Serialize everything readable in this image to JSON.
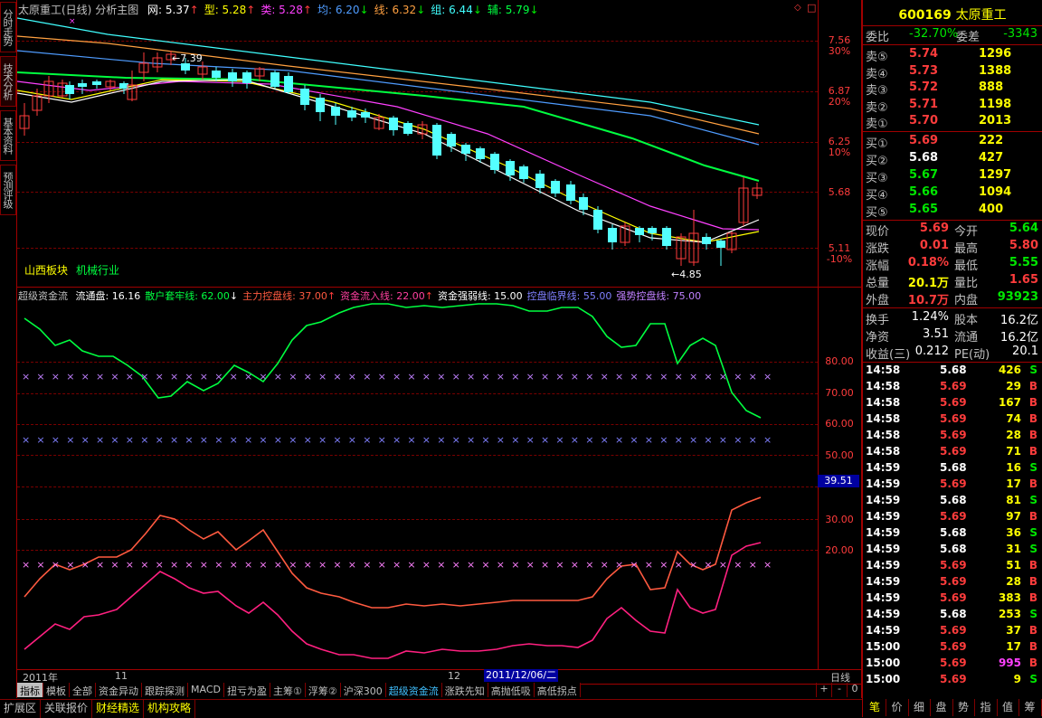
{
  "header": {
    "title": "太原重工(日线)",
    "chart_name": "分析主图",
    "indicators": [
      {
        "label": "网: 5.37",
        "color": "#ffffff",
        "arrow": "↑",
        "arrow_color": "#ff3c3c"
      },
      {
        "label": "型: 5.28",
        "color": "#ffff00",
        "arrow": "↑",
        "arrow_color": "#ff3c3c"
      },
      {
        "label": "类: 5.28",
        "color": "#ff40ff",
        "arrow": "↑",
        "arrow_color": "#ff3c3c"
      },
      {
        "label": "均: 6.20",
        "color": "#4f9cff",
        "arrow": "↓",
        "arrow_color": "#00e600"
      },
      {
        "label": "线: 6.32",
        "color": "#ffa040",
        "arrow": "↓",
        "arrow_color": "#00e600"
      },
      {
        "label": "组: 6.44",
        "color": "#40ffff",
        "arrow": "↓",
        "arrow_color": "#00e600"
      },
      {
        "label": "辅: 5.79",
        "color": "#00ff40",
        "arrow": "↓",
        "arrow_color": "#00e600"
      }
    ]
  },
  "left_tabs": [
    "分时走势",
    "技术分析",
    "基本资料",
    "预测评级"
  ],
  "price_chart": {
    "axis_labels": [
      {
        "price": "7.56",
        "pct": "30%"
      },
      {
        "price": "6.87",
        "pct": "20%"
      },
      {
        "price": "6.25",
        "pct": "10%"
      },
      {
        "price": "5.68",
        "pct": ""
      },
      {
        "price": "5.11",
        "pct": "-10%"
      }
    ],
    "high_marker": "7.39",
    "low_marker": "4.85",
    "sector_label": "山西板块",
    "industry_label": "机械行业"
  },
  "indicator_panel": {
    "name": "超级资金流",
    "items": [
      {
        "label": "流通盘: 16.16",
        "color": "#ffffff",
        "arrow": ""
      },
      {
        "label": "散户套牢线: 62.00",
        "color": "#00ff40",
        "arrow": "↓",
        "arrow_color": "#ffffff"
      },
      {
        "label": "主力控盘线: 37.00",
        "color": "#ff5a40",
        "arrow": "↑",
        "arrow_color": "#ff3c3c"
      },
      {
        "label": "资金流入线: 22.00",
        "color": "#ff40a0",
        "arrow": "↑",
        "arrow_color": "#ff3c3c"
      },
      {
        "label": "资金强弱线: 15.00",
        "color": "#ffffff",
        "arrow": ""
      },
      {
        "label": "控盘临界线: 55.00",
        "color": "#8080ff",
        "arrow": ""
      },
      {
        "label": "强势控盘线: 75.00",
        "color": "#c080ff",
        "arrow": ""
      }
    ],
    "axis_labels": [
      "80.00",
      "70.00",
      "60.00",
      "50.00",
      "30.00",
      "20.00"
    ],
    "cursor_value": "39.51"
  },
  "date_axis": {
    "year_label": "2011年",
    "month_11": "11",
    "month_12": "12",
    "cursor_date": "2011/12/06/二",
    "period": "日线"
  },
  "bottom_tabs": [
    "指标",
    "模板",
    "全部",
    "资金异动",
    "跟踪探测",
    "MACD",
    "扭亏为盈",
    "主筹①",
    "浮筹②",
    "沪深300",
    "超级资金流",
    "涨跌先知",
    "高抛低吸",
    "高低拐点"
  ],
  "zoom_controls": [
    "+",
    "-",
    "0"
  ],
  "status_bar": [
    "扩展区",
    "关联报价",
    "财经精选",
    "机构攻略"
  ],
  "quote": {
    "code": "600169",
    "name": "太原重工",
    "weibi_label": "委比",
    "weibi": "-32.70%",
    "weicha_label": "委差",
    "weicha": "-3343",
    "asks": [
      {
        "label": "卖⑤",
        "price": "5.74",
        "vol": "1296"
      },
      {
        "label": "卖④",
        "price": "5.73",
        "vol": "1388"
      },
      {
        "label": "卖③",
        "price": "5.72",
        "vol": "888"
      },
      {
        "label": "卖②",
        "price": "5.71",
        "vol": "1198"
      },
      {
        "label": "卖①",
        "price": "5.70",
        "vol": "2013"
      }
    ],
    "bids": [
      {
        "label": "买①",
        "price": "5.69",
        "vol": "222",
        "color": "#ff3c3c"
      },
      {
        "label": "买②",
        "price": "5.68",
        "vol": "427",
        "color": "#ffffff"
      },
      {
        "label": "买③",
        "price": "5.67",
        "vol": "1297",
        "color": "#00e600"
      },
      {
        "label": "买④",
        "price": "5.66",
        "vol": "1094",
        "color": "#00e600"
      },
      {
        "label": "买⑤",
        "price": "5.65",
        "vol": "400",
        "color": "#00e600"
      }
    ],
    "stats": [
      {
        "l1": "现价",
        "v1": "5.69",
        "c1": "#ff3c3c",
        "l2": "今开",
        "v2": "5.64",
        "c2": "#00e600"
      },
      {
        "l1": "涨跌",
        "v1": "0.01",
        "c1": "#ff3c3c",
        "l2": "最高",
        "v2": "5.80",
        "c2": "#ff3c3c"
      },
      {
        "l1": "涨幅",
        "v1": "0.18%",
        "c1": "#ff3c3c",
        "l2": "最低",
        "v2": "5.55",
        "c2": "#00e600"
      },
      {
        "l1": "总量",
        "v1": "20.1万",
        "c1": "#ffff00",
        "l2": "量比",
        "v2": "1.65",
        "c2": "#ff3c3c"
      },
      {
        "l1": "外盘",
        "v1": "10.7万",
        "c1": "#ff3c3c",
        "l2": "内盘",
        "v2": "93923",
        "c2": "#00e600"
      }
    ],
    "fundamentals": [
      {
        "l1": "换手",
        "v1": "1.24%",
        "l2": "股本",
        "v2": "16.2亿"
      },
      {
        "l1": "净资",
        "v1": "3.51",
        "l2": "流通",
        "v2": "16.2亿"
      },
      {
        "l1": "收益(三)",
        "v1": "0.212",
        "l2": "PE(动)",
        "v2": "20.1"
      }
    ],
    "ticks": [
      {
        "time": "14:58",
        "price": "5.68",
        "vol": "426",
        "side": "S"
      },
      {
        "time": "14:58",
        "price": "5.69",
        "vol": "29",
        "side": "B"
      },
      {
        "time": "14:58",
        "price": "5.69",
        "vol": "167",
        "side": "B"
      },
      {
        "time": "14:58",
        "price": "5.69",
        "vol": "74",
        "side": "B"
      },
      {
        "time": "14:58",
        "price": "5.69",
        "vol": "28",
        "side": "B"
      },
      {
        "time": "14:58",
        "price": "5.69",
        "vol": "71",
        "side": "B"
      },
      {
        "time": "14:59",
        "price": "5.68",
        "vol": "16",
        "side": "S"
      },
      {
        "time": "14:59",
        "price": "5.69",
        "vol": "17",
        "side": "B"
      },
      {
        "time": "14:59",
        "price": "5.68",
        "vol": "81",
        "side": "S"
      },
      {
        "time": "14:59",
        "price": "5.69",
        "vol": "97",
        "side": "B"
      },
      {
        "time": "14:59",
        "price": "5.68",
        "vol": "36",
        "side": "S"
      },
      {
        "time": "14:59",
        "price": "5.68",
        "vol": "31",
        "side": "S"
      },
      {
        "time": "14:59",
        "price": "5.69",
        "vol": "51",
        "side": "B"
      },
      {
        "time": "14:59",
        "price": "5.69",
        "vol": "28",
        "side": "B"
      },
      {
        "time": "14:59",
        "price": "5.69",
        "vol": "383",
        "side": "B"
      },
      {
        "time": "14:59",
        "price": "5.68",
        "vol": "253",
        "side": "S"
      },
      {
        "time": "14:59",
        "price": "5.69",
        "vol": "37",
        "side": "B"
      },
      {
        "time": "15:00",
        "price": "5.69",
        "vol": "17",
        "side": "B"
      },
      {
        "time": "15:00",
        "price": "5.69",
        "vol": "995",
        "side": "B"
      },
      {
        "time": "15:00",
        "price": "5.69",
        "vol": "9",
        "side": "S"
      }
    ],
    "bottom_tabs": [
      "笔",
      "价",
      "细",
      "盘",
      "势",
      "指",
      "值",
      "筹"
    ]
  },
  "colors": {
    "up": "#ff3c3c",
    "down": "#54ffff",
    "frame": "#a00000"
  }
}
